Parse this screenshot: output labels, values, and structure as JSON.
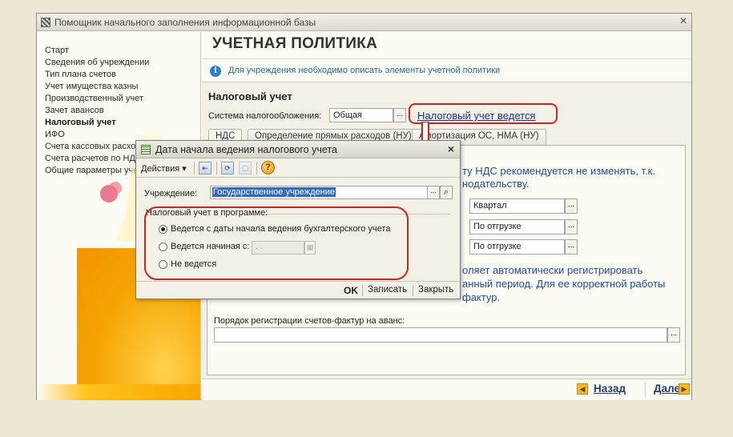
{
  "window": {
    "title": "Помощник начального заполнения информационной базы",
    "close_glyph": "×"
  },
  "sidebar": {
    "items": [
      {
        "label": "Старт"
      },
      {
        "label": "Сведения об учреждении"
      },
      {
        "label": "Тип плана счетов"
      },
      {
        "label": "Учет имущества казны"
      },
      {
        "label": "Производственный учет"
      },
      {
        "label": "Зачет авансов"
      },
      {
        "label": "Налоговый учет",
        "active": true
      },
      {
        "label": "ИФО"
      },
      {
        "label": "Счета кассовых расхо"
      },
      {
        "label": "Счета расчетов по НД"
      },
      {
        "label": "Общие параметры уче"
      }
    ]
  },
  "page": {
    "title": "УЧЕТНАЯ ПОЛИТИКА",
    "info_text": "Для учреждения необходимо описать элементы учетной политики",
    "section_title": "Налоговый учет",
    "tax_system_label": "Система налогообложения:",
    "tax_system_value": "Общая",
    "tax_link": "Налоговый учет ведется",
    "tabs": [
      {
        "label": "НДС",
        "active": true
      },
      {
        "label": "Определение прямых расходов (НУ)"
      },
      {
        "label": "Амортизация ОС, НМА (НУ)"
      }
    ],
    "panel_text_1": "ту НДС рекомендуется не изменять, т.к.",
    "panel_text_2": "нодательству.",
    "panel_fields": [
      "Квартал",
      "По отгрузке",
      "По отгрузке"
    ],
    "panel_text_3": "оляет автоматически регистрировать",
    "panel_text_4": "анный период. Для ее корректной работы",
    "panel_text_5": "фактур.",
    "advance_label": "Порядок регистрации счетов-фактур на аванс:",
    "field_button_glyph": "..."
  },
  "footer": {
    "back_label": "Назад",
    "next_label": "Далее",
    "back_arrow": "◀",
    "next_arrow": "▶"
  },
  "dialog": {
    "title": "Дата начала ведения налогового учета",
    "close_glyph": "×",
    "actions_label": "Действия ▾",
    "help_glyph": "?",
    "institution_label": "Учреждение:",
    "institution_value": "Государственное учреждение",
    "group_label": "Налоговый учет в программе:",
    "radio_1": "Ведется с даты начала ведения бухгалтерского учета",
    "radio_2": "Ведется начиная с:",
    "radio_3": "Не ведется",
    "selected_option": 1,
    "date_value": " .  .",
    "ok_label": "OK",
    "save_label": "Записать",
    "close_label": "Закрыть"
  },
  "colors": {
    "accent_yellow": "#f6a400",
    "highlight_red": "#cc2424",
    "link_blue": "#1b2f92",
    "info_teal": "#1f6f96"
  },
  "icons": [
    "app-icon",
    "close-icon",
    "info-icon",
    "ellipsis-icon",
    "search-icon",
    "calendar-icon",
    "help-icon",
    "arrow-left-icon",
    "arrow-right-icon",
    "flask-icon",
    "red-arrow-icon"
  ]
}
